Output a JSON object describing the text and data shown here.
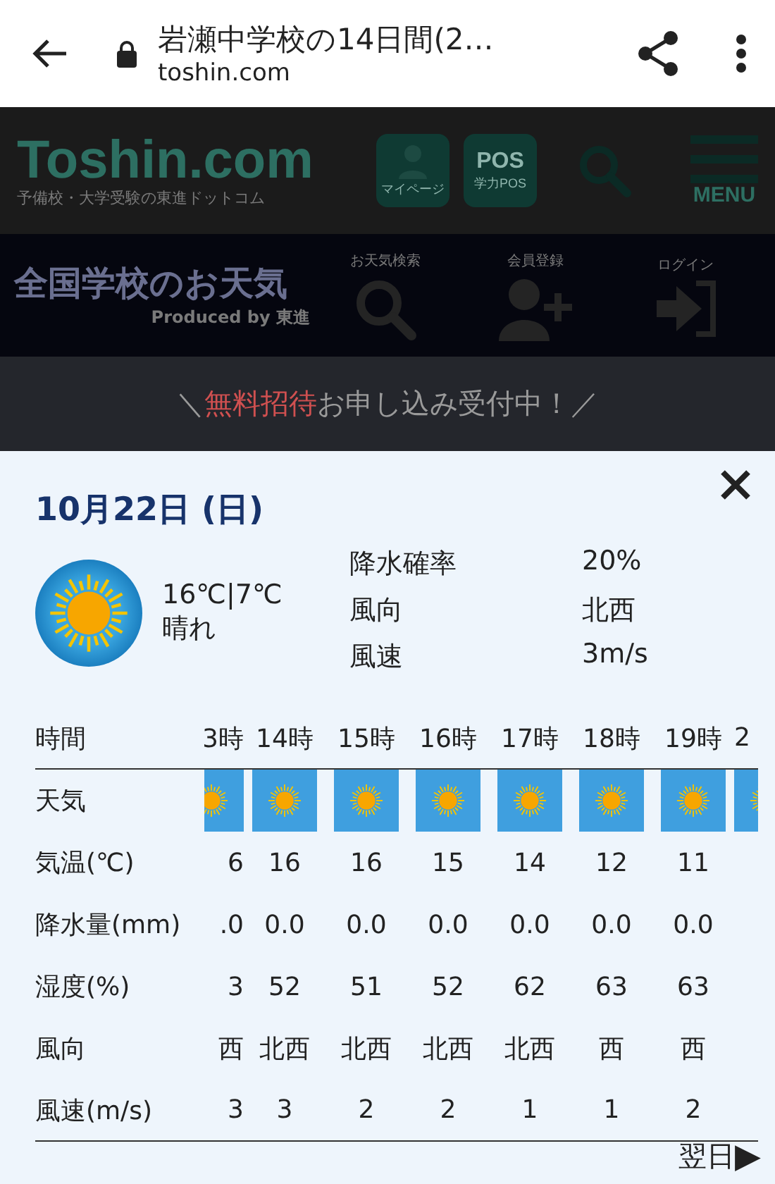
{
  "browser": {
    "title": "岩瀬中学校の14日間(2…",
    "url": "toshin.com"
  },
  "site": {
    "logo": "Toshin.com",
    "tagline": "予備校・大学受験の東進ドットコム",
    "buttons": [
      {
        "kind": "person",
        "label": "マイページ"
      },
      {
        "kind": "pos",
        "badge": "POS",
        "label": "学力POS"
      }
    ],
    "menu_label": "MENU",
    "weather_title": "全国学校のお天気",
    "produced_by": "Produced by 東進",
    "nav": [
      {
        "kind": "search",
        "label": "お天気検索"
      },
      {
        "kind": "register",
        "label": "会員登録"
      },
      {
        "kind": "login",
        "label": "ログイン"
      }
    ],
    "banner": {
      "open": "＼",
      "highlight": "無料招待",
      "rest": "お申し込み受付中！／"
    }
  },
  "modal": {
    "date": "10月22日 (日)",
    "temp": "16℃|7℃",
    "weather": "晴れ",
    "details": [
      {
        "label": "降水確率",
        "value": "20%"
      },
      {
        "label": "風向",
        "value": "北西"
      },
      {
        "label": "風速",
        "value": "3m/s"
      }
    ],
    "row_labels": [
      "時間",
      "天気",
      "気温(℃)",
      "降水量(mm)",
      "湿度(%)",
      "風向",
      "風速(m/s)"
    ],
    "hours": [
      {
        "hour": "3時",
        "temp": "6",
        "rain": ".0",
        "humidity": "3",
        "wind_dir": "西",
        "wind_speed": "3"
      },
      {
        "hour": "14時",
        "temp": "16",
        "rain": "0.0",
        "humidity": "52",
        "wind_dir": "北西",
        "wind_speed": "3"
      },
      {
        "hour": "15時",
        "temp": "16",
        "rain": "0.0",
        "humidity": "51",
        "wind_dir": "北西",
        "wind_speed": "2"
      },
      {
        "hour": "16時",
        "temp": "15",
        "rain": "0.0",
        "humidity": "52",
        "wind_dir": "北西",
        "wind_speed": "2"
      },
      {
        "hour": "17時",
        "temp": "14",
        "rain": "0.0",
        "humidity": "62",
        "wind_dir": "北西",
        "wind_speed": "1"
      },
      {
        "hour": "18時",
        "temp": "12",
        "rain": "0.0",
        "humidity": "63",
        "wind_dir": "西",
        "wind_speed": "1"
      },
      {
        "hour": "19時",
        "temp": "11",
        "rain": "0.0",
        "humidity": "63",
        "wind_dir": "西",
        "wind_speed": "2"
      },
      {
        "hour": "2"
      }
    ],
    "next": "翌日",
    "next_arrow": "▶"
  }
}
